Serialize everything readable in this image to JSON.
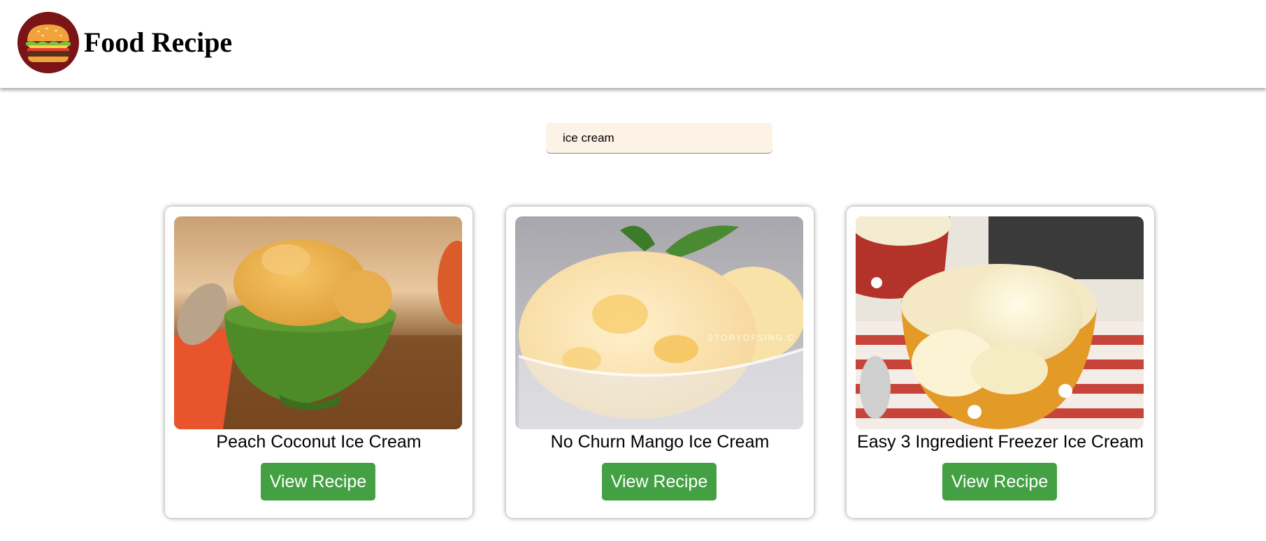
{
  "header": {
    "brand_title": "Food Recipe",
    "logo_icon": "hamburger-icon"
  },
  "search": {
    "value": "ice cream"
  },
  "colors": {
    "button_bg": "#43a143",
    "search_bg": "#fdf2e6",
    "logo_bg": "#7a1416"
  },
  "recipes": [
    {
      "title": "Peach Coconut Ice Cream",
      "button_label": "View Recipe"
    },
    {
      "title": "No Churn Mango Ice Cream",
      "button_label": "View Recipe",
      "image_watermark": "STORYOFSING.C"
    },
    {
      "title": "Easy 3 Ingredient Freezer Ice Cream",
      "button_label": "View Recipe"
    }
  ]
}
